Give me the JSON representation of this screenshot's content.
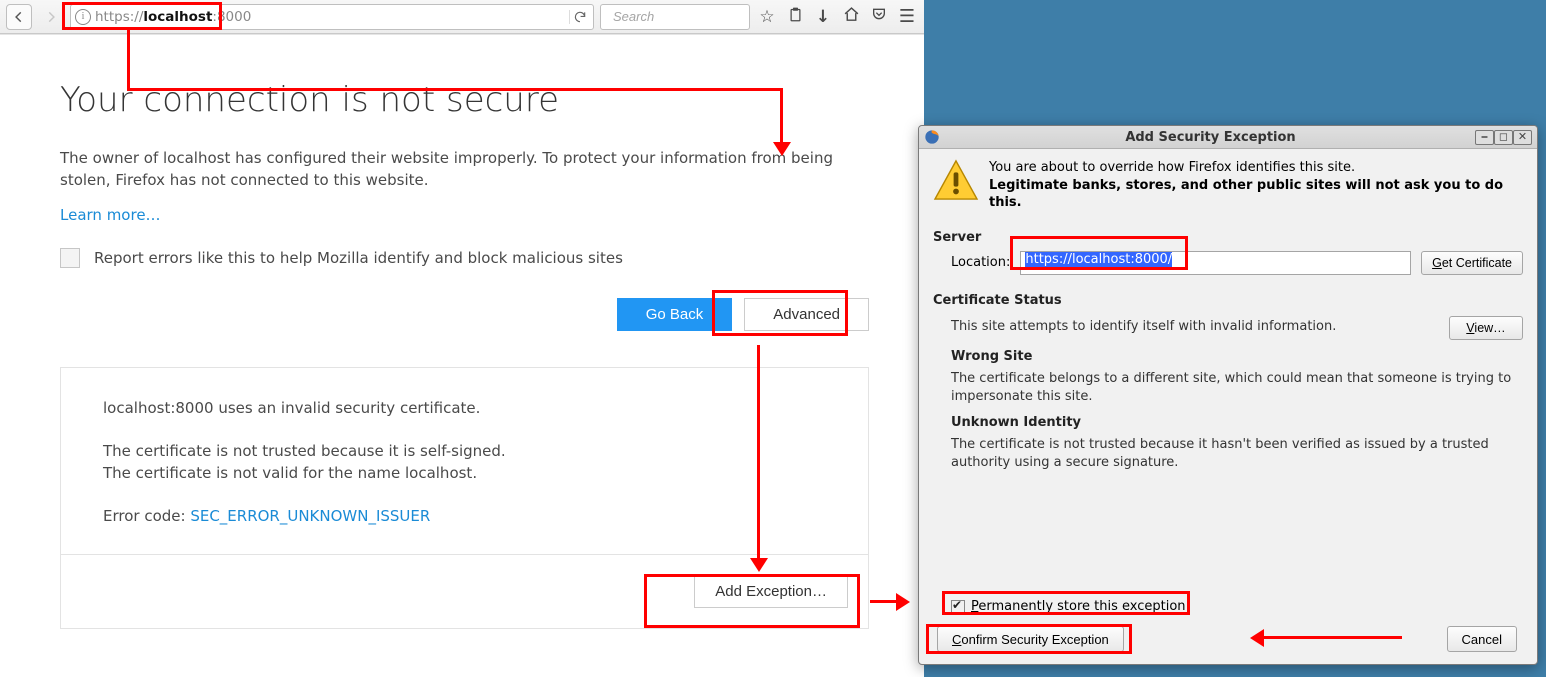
{
  "fx": {
    "url_prefix": "https://",
    "url_host": "localhost",
    "url_suffix": ":8000",
    "search_placeholder": "Search",
    "title": "Your connection is not secure",
    "desc": "The owner of localhost has configured their website improperly. To protect your information from being stolen, Firefox has not connected to this website.",
    "learn": "Learn more…",
    "report": "Report errors like this to help Mozilla identify and block malicious sites",
    "go_back": "Go Back",
    "advanced": "Advanced",
    "cert_l1": "localhost:8000 uses an invalid security certificate.",
    "cert_l2": "The certificate is not trusted because it is self-signed.",
    "cert_l3": "The certificate is not valid for the name localhost.",
    "cert_ecode_label": "Error code: ",
    "cert_ecode": "SEC_ERROR_UNKNOWN_ISSUER",
    "add_exception": "Add Exception…"
  },
  "dlg": {
    "title": "Add Security Exception",
    "line1": "You are about to override how Firefox identifies this site.",
    "line2": "Legitimate banks, stores, and other public sites will not ask you to do this.",
    "server_h": "Server",
    "location_label": "Location:",
    "location_value": "https://localhost:8000/",
    "get_cert": "Get Certificate",
    "cert_status_h": "Certificate Status",
    "cert_status_t": "This site attempts to identify itself with invalid information.",
    "view": "View…",
    "wrong_site_h": "Wrong Site",
    "wrong_site_t": "The certificate belongs to a different site, which could mean that someone is trying to impersonate this site.",
    "unknown_h": "Unknown Identity",
    "unknown_t": "The certificate is not trusted because it hasn't been verified as issued by a trusted authority using a secure signature.",
    "perm_label": "Permanently store this exception",
    "confirm": "Confirm Security Exception",
    "cancel": "Cancel"
  }
}
